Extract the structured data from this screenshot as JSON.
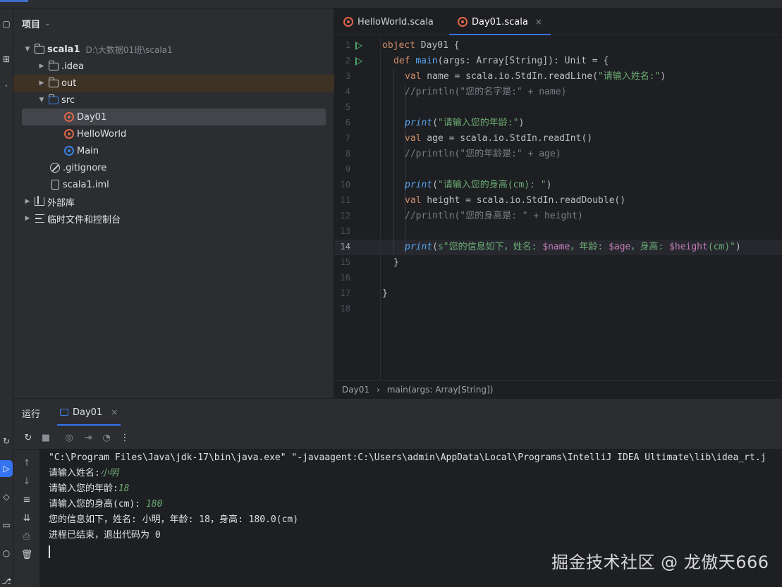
{
  "project_panel": {
    "title": "项目",
    "tree": [
      {
        "label": "scala1",
        "path": "D:\\大数据01班\\scala1",
        "icon": "module-folder-icon"
      },
      {
        "label": ".idea",
        "icon": "folder-icon"
      },
      {
        "label": "out",
        "icon": "folder-icon"
      },
      {
        "label": "src",
        "icon": "folder-icon"
      },
      {
        "label": "Day01",
        "icon": "scala-object-icon"
      },
      {
        "label": "HelloWorld",
        "icon": "scala-object-icon"
      },
      {
        "label": "Main",
        "icon": "scala-class-icon"
      },
      {
        "label": ".gitignore",
        "icon": "gitignore-icon"
      },
      {
        "label": "scala1.iml",
        "icon": "file-icon"
      },
      {
        "label": "外部库",
        "icon": "library-icon"
      },
      {
        "label": "临时文件和控制台",
        "icon": "scratch-icon"
      }
    ]
  },
  "editor": {
    "tabs": [
      {
        "label": "HelloWorld.scala"
      },
      {
        "label": "Day01.scala",
        "close": "×"
      }
    ],
    "line_numbers": [
      "1",
      "2",
      "3",
      "4",
      "5",
      "6",
      "7",
      "8",
      "9",
      "10",
      "11",
      "12",
      "13",
      "14",
      "15",
      "16",
      "17",
      "18"
    ],
    "code": {
      "l1_kw": "object",
      "l1_name": " Day01 {",
      "l2_kw": "def",
      "l2_fn": "main",
      "l2_rest": "(args: Array[String]): Unit = {",
      "l3_kw": "val",
      "l3_mid": " name = scala.io.StdIn.readLine(",
      "l3_str": "\"请输入姓名:\"",
      "l3_end": ")",
      "l4": "//println(\"您的名字是:\" + name)",
      "l6_fn": "print",
      "l6_open": "(",
      "l6_str": "\"请输入您的年龄:\"",
      "l6_end": ")",
      "l7_kw": "val",
      "l7_rest": " age = scala.io.StdIn.readInt()",
      "l8": "//println(\"您的年龄是:\" + age)",
      "l10_fn": "print",
      "l10_open": "(",
      "l10_str": "\"请输入您的身高(cm): \"",
      "l10_end": ")",
      "l11_kw": "val",
      "l11_rest": " height = scala.io.StdIn.readDouble()",
      "l12": "//println(\"您的身高是: \" + height)",
      "l14_fn": "print",
      "l14_open": "(",
      "l14_s": "s",
      "l14_str1": "\"您的信息如下，姓名: ",
      "l14_v1": "$name",
      "l14_str2": "，年龄: ",
      "l14_v2": "$age",
      "l14_str3": "，身高: ",
      "l14_v3": "$height",
      "l14_str4": "(cm)\"",
      "l14_end": ")",
      "l15": "}",
      "l17": "}"
    },
    "breadcrumb": [
      "Day01",
      "main(args: Array[String])"
    ]
  },
  "run_panel": {
    "title": "运行",
    "tab_label": "Day01",
    "tab_close": "×",
    "console": {
      "cmd": "\"C:\\Program Files\\Java\\jdk-17\\bin\\java.exe\" \"-javaagent:C:\\Users\\admin\\AppData\\Local\\Programs\\IntelliJ IDEA Ultimate\\lib\\idea_rt.j",
      "prompt_name": "请输入姓名:",
      "input_name": "小明",
      "prompt_age": "请输入您的年龄:",
      "input_age": "18",
      "prompt_height": "请输入您的身高(cm): ",
      "input_height": "180",
      "result": "您的信息如下，姓名: 小明，年龄: 18，身高: 180.0(cm)",
      "exit": "进程已结束，退出代码为 0"
    }
  },
  "watermark": "掘金技术社区 @ 龙傲天666"
}
